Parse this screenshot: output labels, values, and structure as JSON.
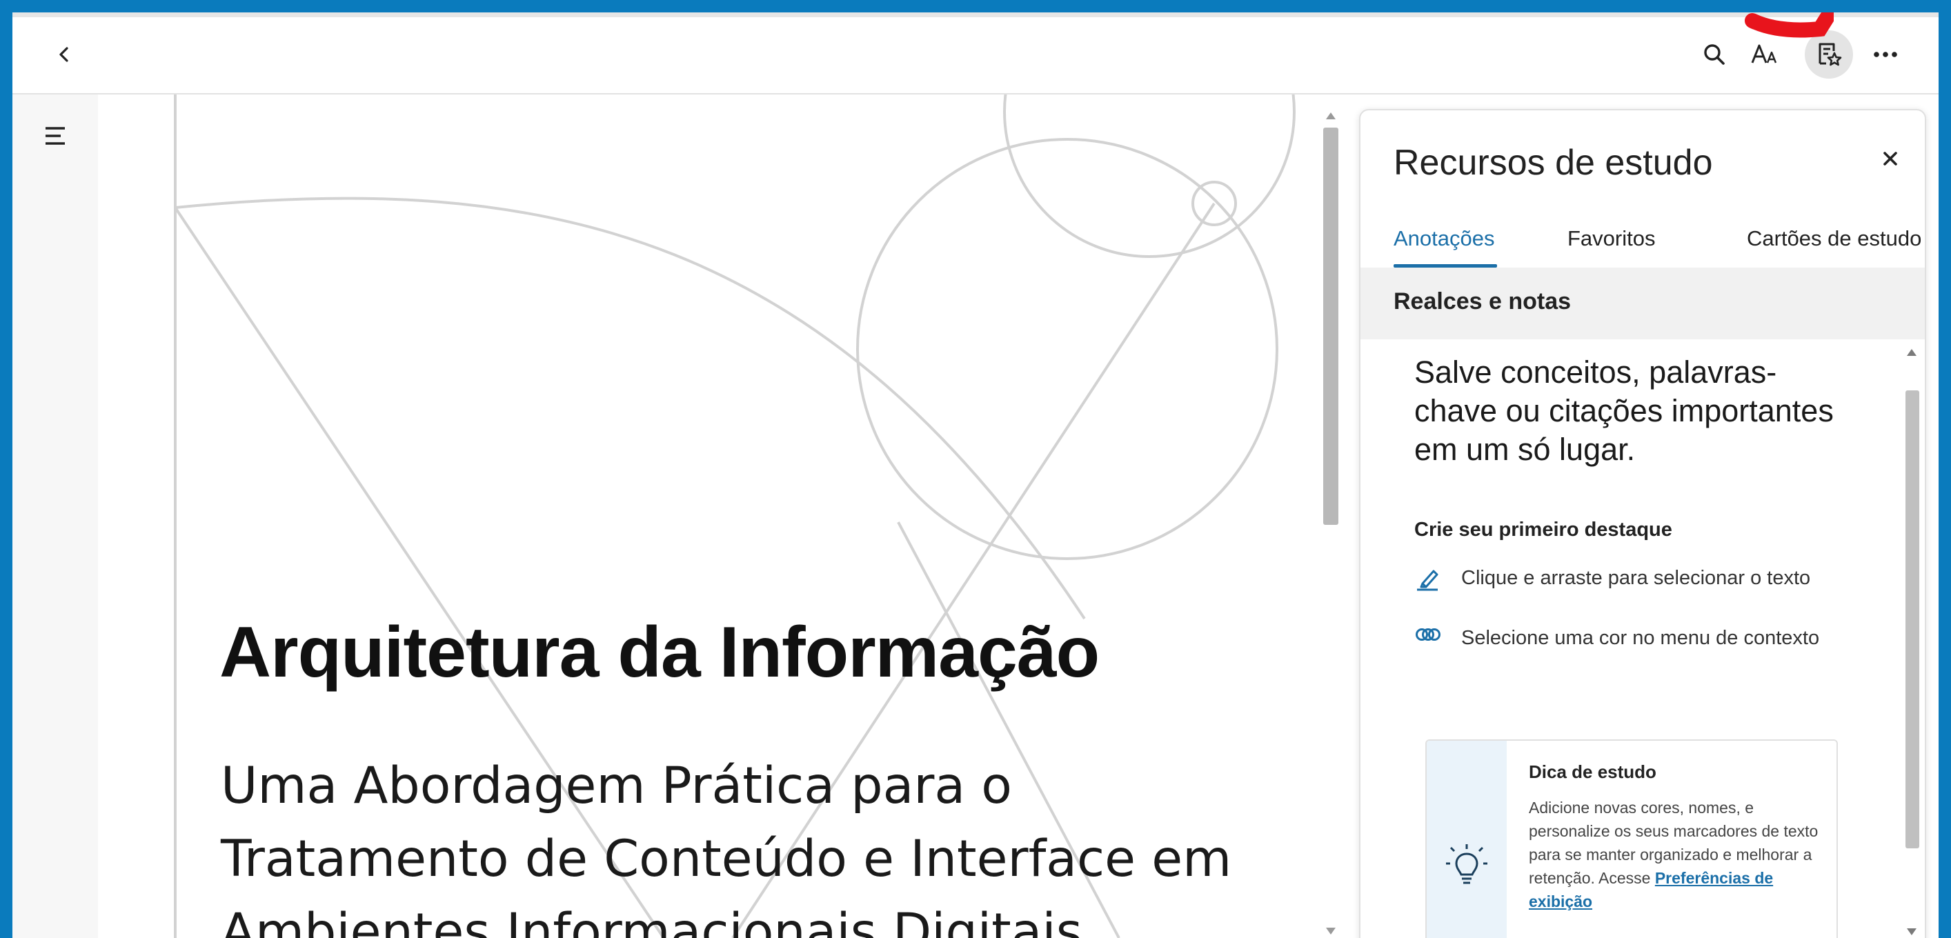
{
  "toolbar": {
    "back_icon": "chevron-left-icon",
    "search_icon": "search-icon",
    "font_icon": "font-size-icon",
    "study_icon": "study-resources-icon",
    "more_icon": "more-horizontal-icon",
    "annotation_color": "#e8141c"
  },
  "left_rail": {
    "toc_icon": "table-of-contents-icon"
  },
  "book": {
    "title": "Arquitetura da Informação",
    "subtitle": "Uma Abordagem Prática para o Tratamento de Conteúdo e Interface em Ambientes Informacionais Digitais"
  },
  "study_panel": {
    "title": "Recursos de estudo",
    "close_icon": "close-icon",
    "tabs": [
      {
        "label": "Anotações",
        "active": true
      },
      {
        "label": "Favoritos",
        "active": false
      },
      {
        "label": "Cartões de estudo",
        "active": false
      }
    ],
    "section_title": "Realces e notas",
    "empty_heading": "Salve conceitos, palavras-chave ou citações importantes em um só lugar.",
    "first_highlight": "Crie seu primeiro destaque",
    "steps": [
      {
        "icon": "highlighter-icon",
        "text": "Clique e arraste para selecionar o texto"
      },
      {
        "icon": "color-circles-icon",
        "text": "Selecione uma cor no menu de contexto"
      }
    ],
    "tip": {
      "icon": "lightbulb-icon",
      "title": "Dica de estudo",
      "body": "Adicione novas cores, nomes, e personalize os seus marcadores de texto para se manter organizado e melhorar a retenção. Acesse",
      "link": "Preferências de exibição"
    }
  },
  "colors": {
    "frame": "#0a7bbd",
    "accent": "#1b6fa8"
  }
}
